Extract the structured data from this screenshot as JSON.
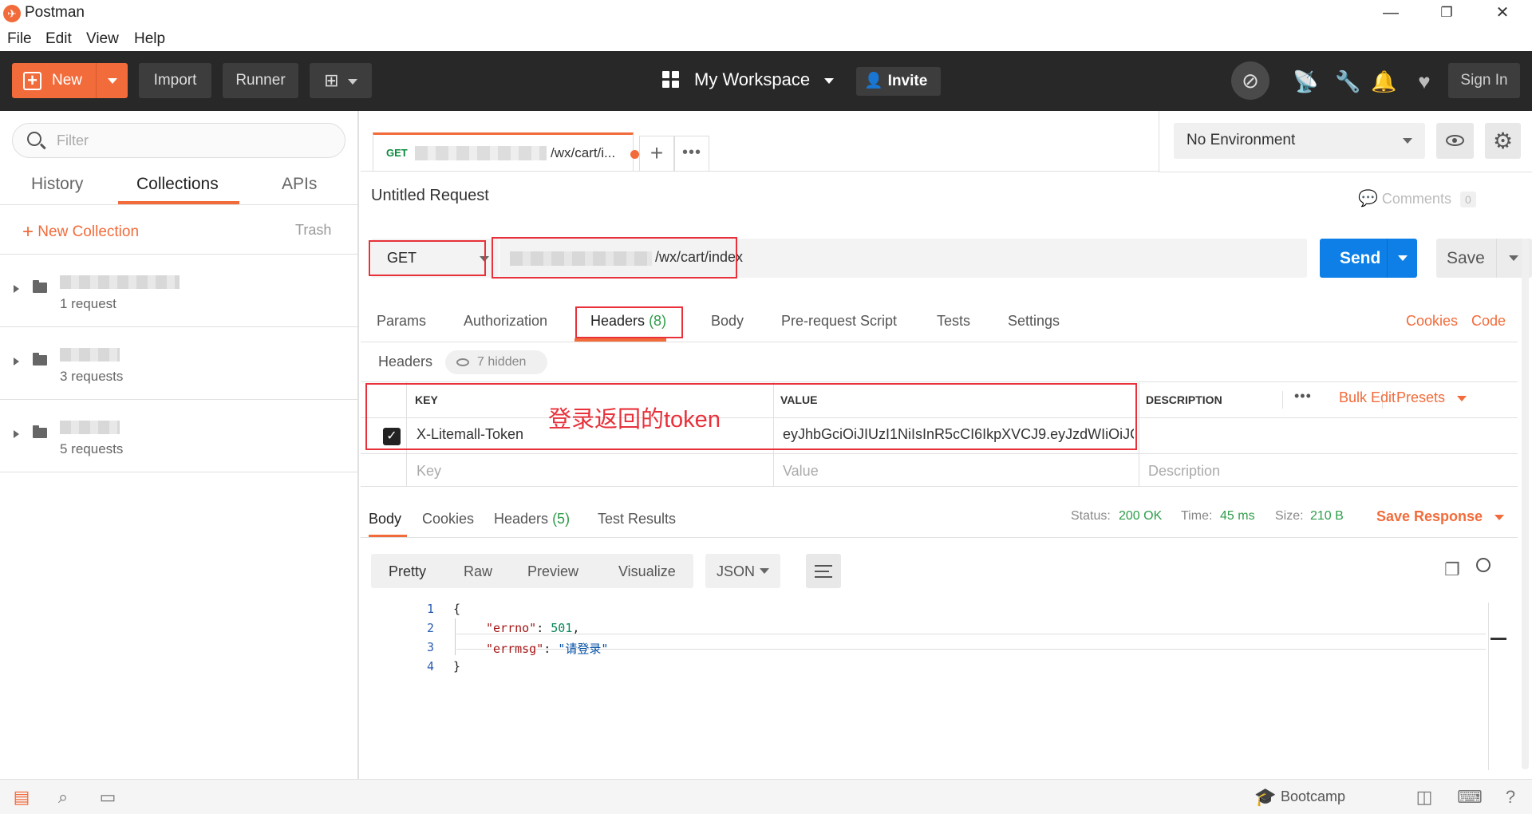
{
  "window": {
    "title": "Postman",
    "minimize": "—",
    "maximize": "❐",
    "close": "✕"
  },
  "menu": [
    "File",
    "Edit",
    "View",
    "Help"
  ],
  "header": {
    "new_label": "New",
    "import_label": "Import",
    "runner_label": "Runner",
    "workspace_label": "My Workspace",
    "invite_label": "Invite",
    "signin_label": "Sign In"
  },
  "sidebar": {
    "filter_placeholder": "Filter",
    "tabs": [
      "History",
      "Collections",
      "APIs"
    ],
    "active_tab": "Collections",
    "new_collection_label": "New Collection",
    "trash_label": "Trash",
    "collections": [
      {
        "count_label": "1 request"
      },
      {
        "count_label": "3 requests"
      },
      {
        "count_label": "5 requests"
      }
    ]
  },
  "request_tab": {
    "method": "GET",
    "url_suffix": "/wx/cart/i..."
  },
  "environment": {
    "selected": "No Environment"
  },
  "request": {
    "title": "Untitled Request",
    "comments_label": "Comments",
    "comments_count": "0",
    "method": "GET",
    "url_suffix": "/wx/cart/index",
    "send_label": "Send",
    "save_label": "Save"
  },
  "request_tabs": [
    {
      "label": "Params"
    },
    {
      "label": "Authorization"
    },
    {
      "label": "Headers",
      "count": "(8)"
    },
    {
      "label": "Body"
    },
    {
      "label": "Pre-request Script"
    },
    {
      "label": "Tests"
    },
    {
      "label": "Settings"
    }
  ],
  "request_links": {
    "cookies": "Cookies",
    "code": "Code"
  },
  "headers_section": {
    "label": "Headers",
    "hidden_label": "7 hidden"
  },
  "headers_table": {
    "col_key": "KEY",
    "col_value": "VALUE",
    "col_description": "DESCRIPTION",
    "bulk_edit": "Bulk Edit",
    "presets": "Presets",
    "rows": [
      {
        "key": "X-Litemall-Token",
        "value": "eyJhbGciOiJIUzI1NiIsInR5cCI6IkpXVCJ9.eyJzdWIiOiJC...",
        "checked": true
      }
    ],
    "placeholder_key": "Key",
    "placeholder_value": "Value",
    "placeholder_description": "Description",
    "annotation": "登录返回的token"
  },
  "response_tabs": [
    {
      "label": "Body"
    },
    {
      "label": "Cookies"
    },
    {
      "label": "Headers",
      "count": "(5)"
    },
    {
      "label": "Test Results"
    }
  ],
  "response_status": {
    "status_label": "Status:",
    "status_value": "200 OK",
    "time_label": "Time:",
    "time_value": "45 ms",
    "size_label": "Size:",
    "size_value": "210 B",
    "save_response": "Save Response"
  },
  "response_view": {
    "modes": [
      "Pretty",
      "Raw",
      "Preview",
      "Visualize"
    ],
    "format": "JSON"
  },
  "response_body": {
    "line_numbers": [
      "1",
      "2",
      "3",
      "4"
    ],
    "open_brace": "{",
    "close_brace": "}",
    "errno_key": "\"errno\"",
    "errno_value": "501",
    "errmsg_key": "\"errmsg\"",
    "errmsg_value": "\"请登录\""
  },
  "footer": {
    "bootcamp_label": "Bootcamp"
  },
  "colors": {
    "accent": "#f26b3a",
    "send": "#0d7fe6",
    "annotation": "#e8313a",
    "success": "#2e9d4a"
  }
}
